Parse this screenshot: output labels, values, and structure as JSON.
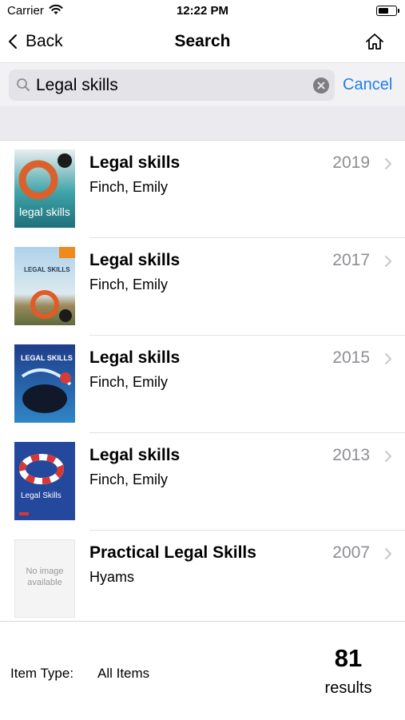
{
  "status_bar": {
    "carrier": "Carrier",
    "time": "12:22 PM"
  },
  "nav": {
    "back_label": "Back",
    "title": "Search"
  },
  "search": {
    "query": "Legal skills",
    "cancel_label": "Cancel"
  },
  "results": [
    {
      "title": "Legal skills",
      "author": "Finch, Emily",
      "year": "2019",
      "cover_text": "legal skills"
    },
    {
      "title": "Legal skills",
      "author": "Finch, Emily",
      "year": "2017",
      "cover_text": "LEGAL SKILLS"
    },
    {
      "title": "Legal skills",
      "author": "Finch, Emily",
      "year": "2015",
      "cover_text": "LEGAL SKILLS"
    },
    {
      "title": "Legal skills",
      "author": "Finch, Emily",
      "year": "2013",
      "cover_text": "Legal Skills"
    },
    {
      "title": "Practical Legal Skills",
      "author": "Hyams",
      "year": "2007",
      "cover_text": "No image available"
    }
  ],
  "footer": {
    "item_type_label": "Item Type:",
    "item_type_value": "All Items",
    "results_count": "81",
    "results_label": "results"
  },
  "colors": {
    "accent": "#1f7fe6",
    "secondary_text": "#8e8e93"
  }
}
